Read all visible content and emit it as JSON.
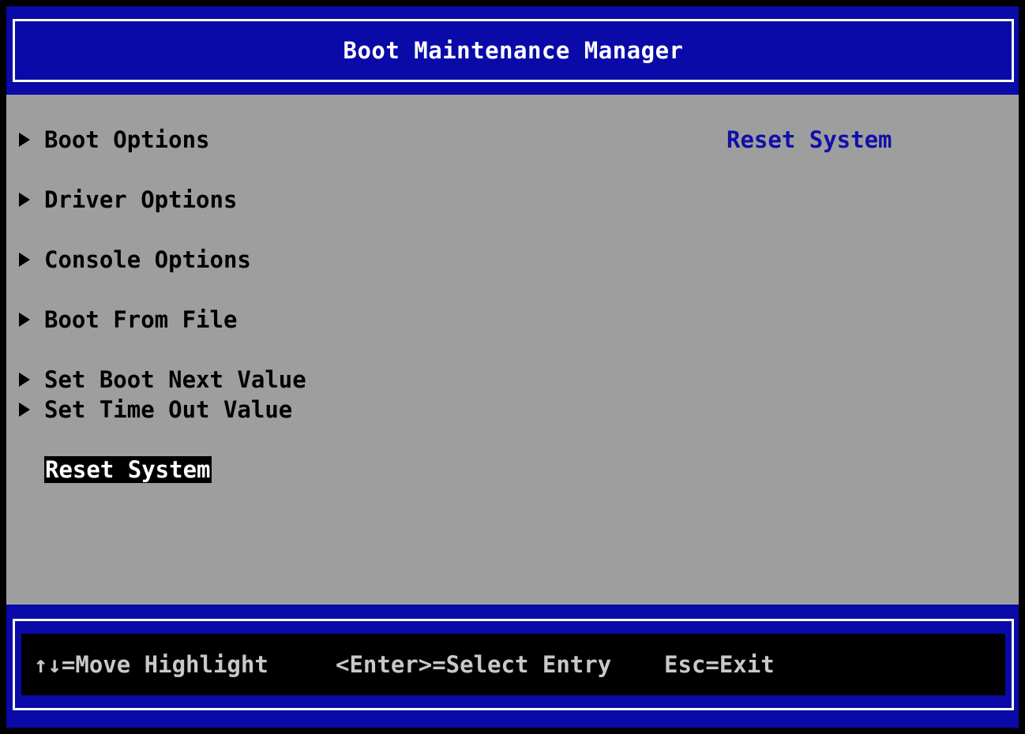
{
  "header": {
    "title": "Boot Maintenance Manager"
  },
  "menu": {
    "items": [
      {
        "label": "Boot Options"
      },
      {
        "label": "Driver Options"
      },
      {
        "label": "Console Options"
      },
      {
        "label": "Boot From File"
      },
      {
        "label": "Set Boot Next Value"
      },
      {
        "label": "Set Time Out Value"
      }
    ],
    "selected_label": "Reset System"
  },
  "help": {
    "text": "Reset System"
  },
  "footer": {
    "move_hint": "↑↓=Move Highlight",
    "enter_hint": "<Enter>=Select Entry",
    "esc_hint": "Esc=Exit"
  },
  "colors": {
    "frame_blue": "#0a0aa8",
    "panel_gray": "#9e9e9e",
    "help_blue": "#1010a8",
    "highlight_bg": "#000000",
    "highlight_fg": "#ffffff"
  }
}
